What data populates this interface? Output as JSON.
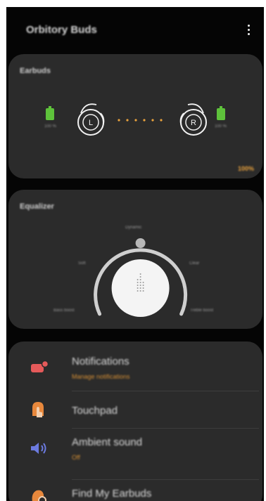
{
  "app": {
    "title": "Orbitory Buds",
    "menu_icon": "more-vert-icon"
  },
  "earbuds": {
    "title": "Earbuds",
    "left": {
      "label": "L",
      "battery": "100 %",
      "battery_level": 1.0
    },
    "right": {
      "label": "R",
      "battery": "100 %",
      "battery_level": 1.0
    },
    "case_battery": "100%",
    "colors": {
      "battery": "#5ec23b",
      "accent": "#e9a23d"
    }
  },
  "equalizer": {
    "title": "Equalizer",
    "presets": [
      "Bass boost",
      "Soft",
      "Dynamic",
      "Clear",
      "Treble boost"
    ],
    "selected": "Dynamic"
  },
  "menu": {
    "items": [
      {
        "title": "Notifications",
        "subtitle": "Manage notifications",
        "icon": "notification-icon",
        "color": "#e55a5a"
      },
      {
        "title": "Touchpad",
        "subtitle": "",
        "icon": "touchpad-icon",
        "color": "#e8883c"
      },
      {
        "title": "Ambient sound",
        "subtitle": "Off",
        "icon": "speaker-icon",
        "color": "#6c7be0"
      },
      {
        "title": "Find My Earbuds",
        "subtitle": "",
        "icon": "find-earbuds-icon",
        "color": "#e8883c"
      }
    ]
  }
}
